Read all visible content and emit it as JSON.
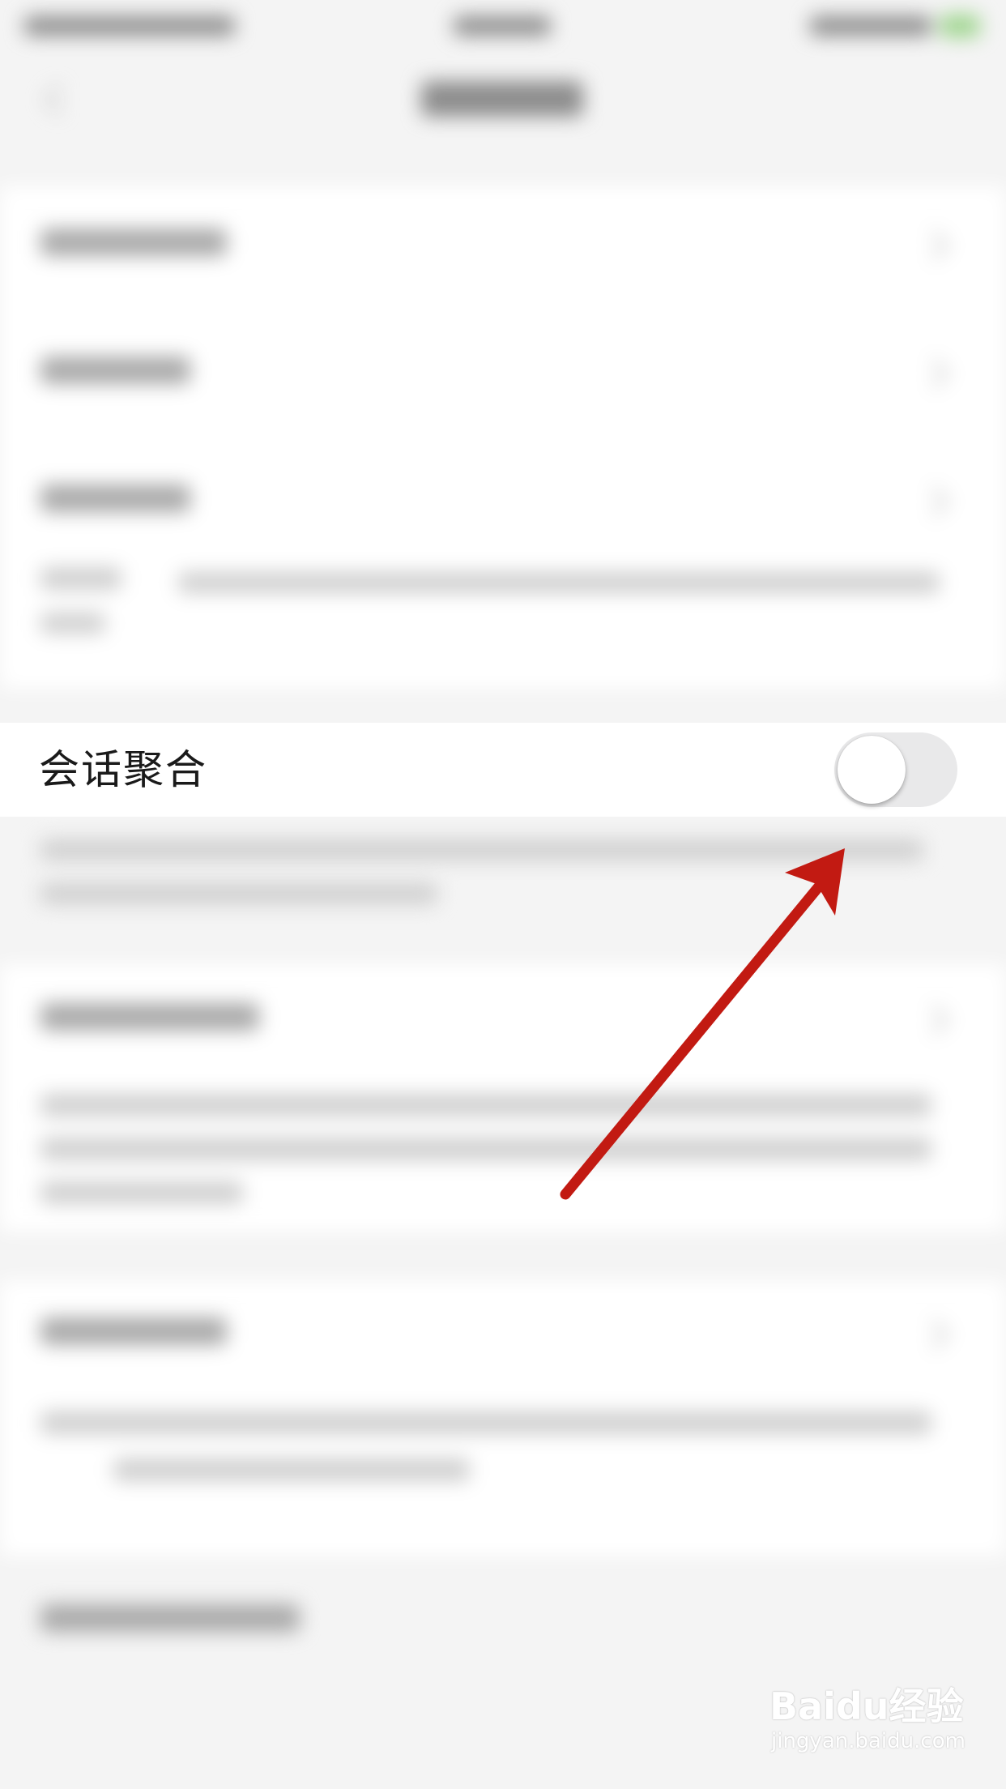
{
  "setting_row": {
    "label": "会话聚合",
    "toggle_on": false
  },
  "watermark": {
    "brand": "Baidu经验",
    "url": "jingyan.baidu.com"
  },
  "colors": {
    "background": "#f4f4f4",
    "row_background": "#ffffff",
    "toggle_track_off": "#e9e9ea",
    "annotation_arrow": "#c21a12"
  }
}
